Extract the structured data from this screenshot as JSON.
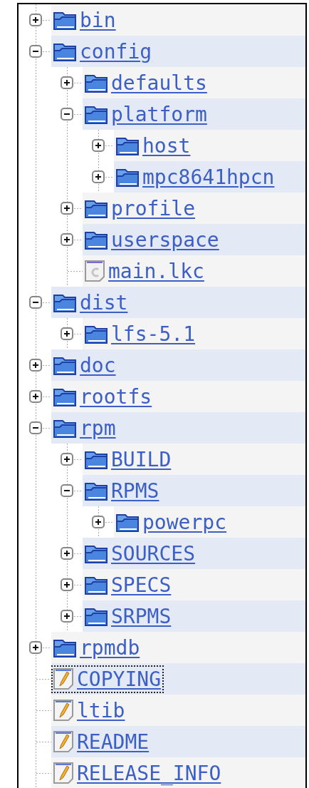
{
  "tree": [
    {
      "label": "bin",
      "kind": "folder",
      "expanded": false,
      "selected": false
    },
    {
      "label": "config",
      "kind": "folder",
      "expanded": true,
      "selected": false,
      "children": [
        {
          "label": "defaults",
          "kind": "folder",
          "expanded": false,
          "selected": false
        },
        {
          "label": "platform",
          "kind": "folder",
          "expanded": true,
          "selected": false,
          "children": [
            {
              "label": "host",
              "kind": "folder",
              "expanded": false,
              "selected": false
            },
            {
              "label": "mpc8641hpcn",
              "kind": "folder",
              "expanded": false,
              "selected": false
            }
          ]
        },
        {
          "label": "profile",
          "kind": "folder",
          "expanded": false,
          "selected": false
        },
        {
          "label": "userspace",
          "kind": "folder",
          "expanded": false,
          "selected": false
        },
        {
          "label": "main.lkc",
          "kind": "source",
          "selected": false
        }
      ]
    },
    {
      "label": "dist",
      "kind": "folder",
      "expanded": true,
      "selected": false,
      "children": [
        {
          "label": "lfs-5.1",
          "kind": "folder",
          "expanded": false,
          "selected": false
        }
      ]
    },
    {
      "label": "doc",
      "kind": "folder",
      "expanded": false,
      "selected": false
    },
    {
      "label": "rootfs",
      "kind": "folder",
      "expanded": false,
      "selected": false
    },
    {
      "label": "rpm",
      "kind": "folder",
      "expanded": true,
      "selected": false,
      "children": [
        {
          "label": "BUILD",
          "kind": "folder",
          "expanded": false,
          "selected": false
        },
        {
          "label": "RPMS",
          "kind": "folder",
          "expanded": true,
          "selected": false,
          "children": [
            {
              "label": "powerpc",
              "kind": "folder",
              "expanded": false,
              "selected": false
            }
          ]
        },
        {
          "label": "SOURCES",
          "kind": "folder",
          "expanded": false,
          "selected": false
        },
        {
          "label": "SPECS",
          "kind": "folder",
          "expanded": false,
          "selected": false
        },
        {
          "label": "SRPMS",
          "kind": "folder",
          "expanded": false,
          "selected": false
        }
      ]
    },
    {
      "label": "rpmdb",
      "kind": "folder",
      "expanded": false,
      "selected": false
    },
    {
      "label": "COPYING",
      "kind": "text",
      "selected": true
    },
    {
      "label": "ltib",
      "kind": "text",
      "selected": false
    },
    {
      "label": "README",
      "kind": "text",
      "selected": false
    },
    {
      "label": "RELEASE_INFO",
      "kind": "text",
      "selected": false
    }
  ]
}
